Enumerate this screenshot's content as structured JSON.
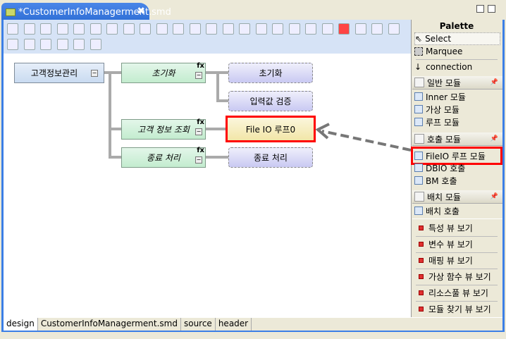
{
  "editor": {
    "tab_title": "*CustomerInfoManagerment.smd",
    "close": "✖"
  },
  "diagram": {
    "root": "고객정보관리",
    "functions": [
      {
        "label": "초기화",
        "badge": "fx"
      },
      {
        "label": "고객 정보 조회",
        "badge": "fx"
      },
      {
        "label": "종료 처리",
        "badge": "fx"
      }
    ],
    "modules": [
      "초기화",
      "입력값 검증",
      "File IO 루프0",
      "종료 처리"
    ]
  },
  "palette": {
    "title": "Palette",
    "tools": [
      "Select",
      "Marquee",
      "connection"
    ],
    "drawers": [
      {
        "label": "일반 모듈",
        "items": [
          "Inner 모듈",
          "가상 모듈",
          "루프 모듈"
        ]
      },
      {
        "label": "호출 모듈",
        "items": [
          "FileIO 루프 모듈",
          "DBIO 호출",
          "BM 호출"
        ]
      },
      {
        "label": "배치 모듈",
        "items": [
          "배치 호출"
        ]
      }
    ],
    "views": [
      "특성 뷰 보기",
      "변수 뷰 보기",
      "매핑 뷰 보기",
      "가상 함수 뷰 보기",
      "리소스풀 뷰 보기",
      "모듈 찾기 뷰 보기"
    ]
  },
  "bottom_tabs": [
    "design",
    "CustomerInfoManagerment.smd",
    "source",
    "header"
  ],
  "colors": {
    "highlight": "#ff0000",
    "frame": "#3c7fe6"
  }
}
